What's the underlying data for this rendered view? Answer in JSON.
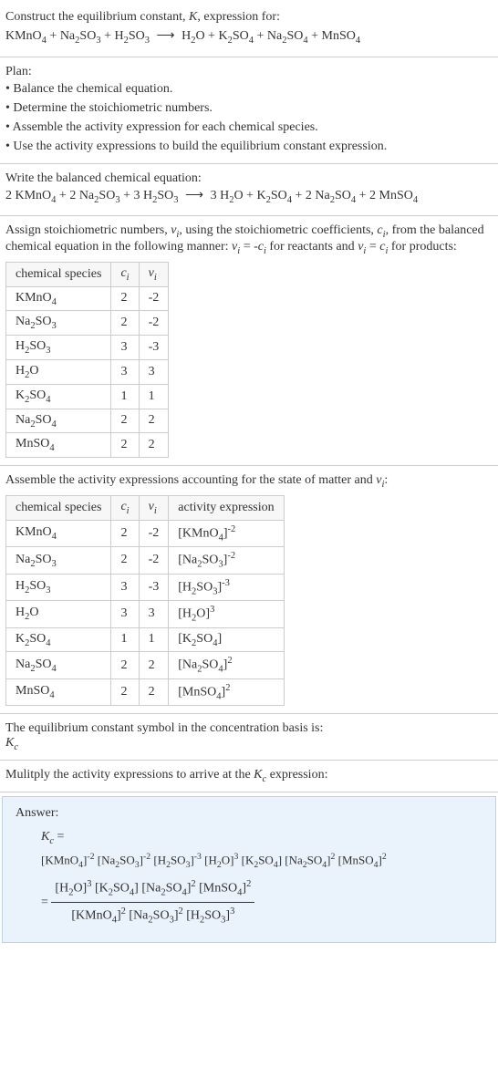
{
  "intro": {
    "line1": "Construct the equilibrium constant, K, expression for:",
    "eq": "KMnO₄ + Na₂SO₃ + H₂SO₃ ⟶ H₂O + K₂SO₄ + Na₂SO₄ + MnSO₄"
  },
  "plan": {
    "title": "Plan:",
    "items": [
      "• Balance the chemical equation.",
      "• Determine the stoichiometric numbers.",
      "• Assemble the activity expression for each chemical species.",
      "• Use the activity expressions to build the equilibrium constant expression."
    ]
  },
  "balanced": {
    "title": "Write the balanced chemical equation:",
    "eq": "2 KMnO₄ + 2 Na₂SO₃ + 3 H₂SO₃ ⟶ 3 H₂O + K₂SO₄ + 2 Na₂SO₄ + 2 MnSO₄"
  },
  "assign": {
    "text": "Assign stoichiometric numbers, νᵢ, using the stoichiometric coefficients, cᵢ, from the balanced chemical equation in the following manner: νᵢ = -cᵢ for reactants and νᵢ = cᵢ for products:",
    "headers": [
      "chemical species",
      "cᵢ",
      "νᵢ"
    ],
    "rows": [
      [
        "KMnO₄",
        "2",
        "-2"
      ],
      [
        "Na₂SO₃",
        "2",
        "-2"
      ],
      [
        "H₂SO₃",
        "3",
        "-3"
      ],
      [
        "H₂O",
        "3",
        "3"
      ],
      [
        "K₂SO₄",
        "1",
        "1"
      ],
      [
        "Na₂SO₄",
        "2",
        "2"
      ],
      [
        "MnSO₄",
        "2",
        "2"
      ]
    ]
  },
  "activity": {
    "title": "Assemble the activity expressions accounting for the state of matter and νᵢ:",
    "headers": [
      "chemical species",
      "cᵢ",
      "νᵢ",
      "activity expression"
    ],
    "rows": [
      [
        "KMnO₄",
        "2",
        "-2",
        "[KMnO₄]⁻²"
      ],
      [
        "Na₂SO₃",
        "2",
        "-2",
        "[Na₂SO₃]⁻²"
      ],
      [
        "H₂SO₃",
        "3",
        "-3",
        "[H₂SO₃]⁻³"
      ],
      [
        "H₂O",
        "3",
        "3",
        "[H₂O]³"
      ],
      [
        "K₂SO₄",
        "1",
        "1",
        "[K₂SO₄]"
      ],
      [
        "Na₂SO₄",
        "2",
        "2",
        "[Na₂SO₄]²"
      ],
      [
        "MnSO₄",
        "2",
        "2",
        "[MnSO₄]²"
      ]
    ]
  },
  "symbol": {
    "line1": "The equilibrium constant symbol in the concentration basis is:",
    "line2": "K_c"
  },
  "multiply": {
    "title": "Mulitply the activity expressions to arrive at the K_c expression:"
  },
  "answer": {
    "label": "Answer:",
    "kc_eq": "K_c =",
    "expanded": "[KMnO₄]⁻² [Na₂SO₃]⁻² [H₂SO₃]⁻³ [H₂O]³ [K₂SO₄] [Na₂SO₄]² [MnSO₄]²",
    "frac_num": "[H₂O]³ [K₂SO₄] [Na₂SO₄]² [MnSO₄]²",
    "frac_den": "[KMnO₄]² [Na₂SO₃]² [H₂SO₃]³",
    "equals": "="
  },
  "chart_data": {
    "type": "table",
    "tables": [
      {
        "title": "Stoichiometric numbers",
        "columns": [
          "chemical species",
          "c_i",
          "ν_i"
        ],
        "rows": [
          {
            "species": "KMnO4",
            "c_i": 2,
            "nu_i": -2
          },
          {
            "species": "Na2SO3",
            "c_i": 2,
            "nu_i": -2
          },
          {
            "species": "H2SO3",
            "c_i": 3,
            "nu_i": -3
          },
          {
            "species": "H2O",
            "c_i": 3,
            "nu_i": 3
          },
          {
            "species": "K2SO4",
            "c_i": 1,
            "nu_i": 1
          },
          {
            "species": "Na2SO4",
            "c_i": 2,
            "nu_i": 2
          },
          {
            "species": "MnSO4",
            "c_i": 2,
            "nu_i": 2
          }
        ]
      },
      {
        "title": "Activity expressions",
        "columns": [
          "chemical species",
          "c_i",
          "ν_i",
          "activity expression"
        ],
        "rows": [
          {
            "species": "KMnO4",
            "c_i": 2,
            "nu_i": -2,
            "activity": "[KMnO4]^-2"
          },
          {
            "species": "Na2SO3",
            "c_i": 2,
            "nu_i": -2,
            "activity": "[Na2SO3]^-2"
          },
          {
            "species": "H2SO3",
            "c_i": 3,
            "nu_i": -3,
            "activity": "[H2SO3]^-3"
          },
          {
            "species": "H2O",
            "c_i": 3,
            "nu_i": 3,
            "activity": "[H2O]^3"
          },
          {
            "species": "K2SO4",
            "c_i": 1,
            "nu_i": 1,
            "activity": "[K2SO4]"
          },
          {
            "species": "Na2SO4",
            "c_i": 2,
            "nu_i": 2,
            "activity": "[Na2SO4]^2"
          },
          {
            "species": "MnSO4",
            "c_i": 2,
            "nu_i": 2,
            "activity": "[MnSO4]^2"
          }
        ]
      }
    ],
    "balanced_equation": "2 KMnO4 + 2 Na2SO3 + 3 H2SO3 -> 3 H2O + K2SO4 + 2 Na2SO4 + 2 MnSO4",
    "Kc_expression": "([H2O]^3 [K2SO4] [Na2SO4]^2 [MnSO4]^2) / ([KMnO4]^2 [Na2SO3]^2 [H2SO3]^3)"
  }
}
